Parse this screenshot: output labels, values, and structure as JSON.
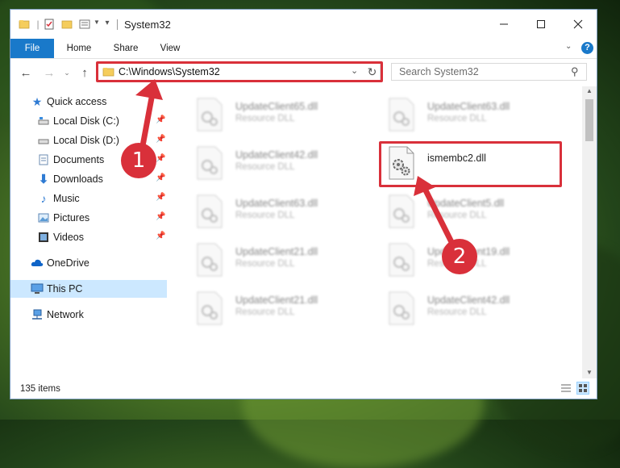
{
  "window": {
    "title": "System32",
    "min_icon": "minimize-icon",
    "max_icon": "maximize-icon",
    "close_icon": "close-icon"
  },
  "ribbon": {
    "tabs": [
      {
        "label": "File"
      },
      {
        "label": "Home"
      },
      {
        "label": "Share"
      },
      {
        "label": "View"
      }
    ]
  },
  "nav": {
    "address": "C:\\Windows\\System32",
    "search_placeholder": "Search System32"
  },
  "sidebar": {
    "items": [
      {
        "label": "Quick access"
      },
      {
        "label": "Local Disk (C:)"
      },
      {
        "label": "Local Disk (D:)"
      },
      {
        "label": "Documents"
      },
      {
        "label": "Downloads"
      },
      {
        "label": "Music"
      },
      {
        "label": "Pictures"
      },
      {
        "label": "Videos"
      },
      {
        "label": "OneDrive"
      },
      {
        "label": "This PC"
      },
      {
        "label": "Network"
      }
    ]
  },
  "files": {
    "left": [
      {
        "name": "UpdateClient65.dll",
        "type": "Resource DLL"
      },
      {
        "name": "UpdateClient42.dll",
        "type": "Resource DLL"
      },
      {
        "name": "UpdateClient63.dll",
        "type": "Resource DLL"
      },
      {
        "name": "UpdateClient21.dll",
        "type": "Resource DLL"
      },
      {
        "name": "UpdateClient21.dll",
        "type": "Resource DLL"
      }
    ],
    "right": [
      {
        "name": "UpdateClient63.dll",
        "type": "Resource DLL"
      },
      {
        "name": "ismembc2.dll",
        "type": ""
      },
      {
        "name": "UpdateClient5.dll",
        "type": "Resource DLL"
      },
      {
        "name": "UpdateClient19.dll",
        "type": "Resource DLL"
      },
      {
        "name": "UpdateClient42.dll",
        "type": "Resource DLL"
      }
    ]
  },
  "status": {
    "count": "135 items"
  },
  "callouts": {
    "one": "1",
    "two": "2"
  },
  "colors": {
    "accent": "#1979ca",
    "highlight": "#d9303a",
    "selected": "#cce8ff"
  }
}
